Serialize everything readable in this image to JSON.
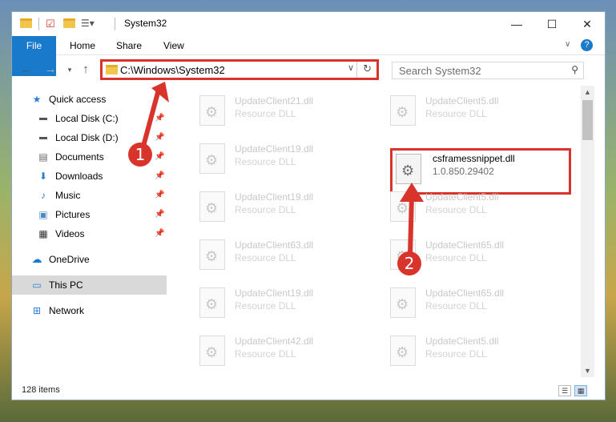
{
  "window": {
    "title": "System32",
    "controls": {
      "minimize": "—",
      "maximize": "☐",
      "close": "✕"
    }
  },
  "ribbon": {
    "tabs": [
      "File",
      "Home",
      "Share",
      "View"
    ],
    "help": "?"
  },
  "address": {
    "path": "C:\\Windows\\System32",
    "search_placeholder": "Search System32"
  },
  "sidebar": {
    "items": [
      {
        "label": "Quick access",
        "icon": "star-icon"
      },
      {
        "label": "Local Disk (C:)",
        "icon": "drive-icon",
        "pinned": true
      },
      {
        "label": "Local Disk (D:)",
        "icon": "drive-icon",
        "pinned": true
      },
      {
        "label": "Documents",
        "icon": "documents-icon",
        "pinned": true
      },
      {
        "label": "Downloads",
        "icon": "downloads-icon",
        "pinned": true
      },
      {
        "label": "Music",
        "icon": "music-icon",
        "pinned": true
      },
      {
        "label": "Pictures",
        "icon": "pictures-icon",
        "pinned": true
      },
      {
        "label": "Videos",
        "icon": "videos-icon",
        "pinned": true
      },
      {
        "label": "OneDrive",
        "icon": "cloud-icon"
      },
      {
        "label": "This PC",
        "icon": "computer-icon",
        "selected": true
      },
      {
        "label": "Network",
        "icon": "network-icon"
      }
    ]
  },
  "files": [
    {
      "name": "UpdateClient21.dll",
      "desc": "Resource DLL"
    },
    {
      "name": "UpdateClient5.dll",
      "desc": "Resource DLL"
    },
    {
      "name": "UpdateClient19.dll",
      "desc": "Resource DLL"
    },
    {
      "name": "csframessnippet.dll",
      "desc": "1.0.850.29402",
      "highlighted": true
    },
    {
      "name": "UpdateClient19.dll",
      "desc": "Resource DLL"
    },
    {
      "name": "UpdateClient5.dll",
      "desc": "Resource DLL"
    },
    {
      "name": "UpdateClient63.dll",
      "desc": "Resource DLL"
    },
    {
      "name": "UpdateClient65.dll",
      "desc": "Resource DLL"
    },
    {
      "name": "UpdateClient19.dll",
      "desc": "Resource DLL"
    },
    {
      "name": "UpdateClient65.dll",
      "desc": "Resource DLL"
    },
    {
      "name": "UpdateClient42.dll",
      "desc": "Resource DLL"
    },
    {
      "name": "UpdateClient5.dll",
      "desc": "Resource DLL"
    }
  ],
  "status": {
    "item_count": "128 items"
  },
  "annotations": {
    "step1": "1",
    "step2": "2"
  },
  "colors": {
    "accent": "#1979ca",
    "highlight": "#d9342b",
    "selected_bg": "#d9d9d9"
  }
}
